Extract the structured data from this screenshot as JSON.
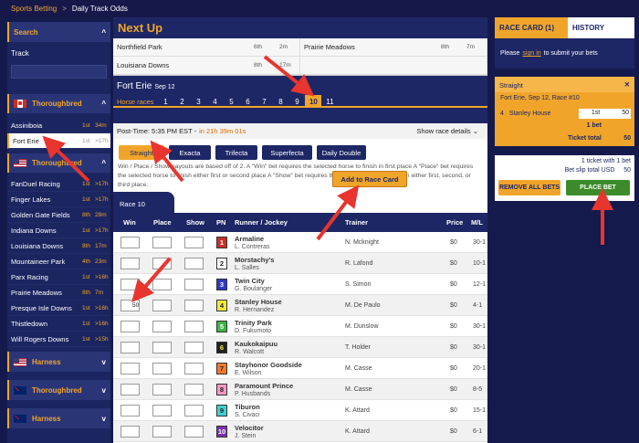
{
  "breadcrumb": {
    "parent": "Sports Betting",
    "separator": ">",
    "current": "Daily Track Odds"
  },
  "sidebar": {
    "search_label": "Search",
    "track_label": "Track",
    "groups": [
      {
        "label": "Thoroughbred",
        "flag": "canada-flag"
      },
      {
        "label": "Thoroughbred",
        "flag": "usa-flag"
      },
      {
        "label": "Harness",
        "flag": "usa-flag"
      },
      {
        "label": "Thoroughbred",
        "flag": "australia-flag"
      },
      {
        "label": "Harness",
        "flag": "australia-flag"
      }
    ],
    "canada_tracks": [
      {
        "name": "Assiniboia",
        "pos": "1st",
        "dist": "34m"
      },
      {
        "name": "Fort Erie",
        "pos": "1st",
        "dist": ">17h"
      }
    ],
    "usa_tracks": [
      {
        "name": "FanDuel Racing",
        "pos": "1st",
        "dist": ">17h"
      },
      {
        "name": "Finger Lakes",
        "pos": "1st",
        "dist": ">17h"
      },
      {
        "name": "Golden Gate Fields",
        "pos": "8th",
        "dist": "28m"
      },
      {
        "name": "Indiana Downs",
        "pos": "1st",
        "dist": ">17h"
      },
      {
        "name": "Louisiana Downs",
        "pos": "8th",
        "dist": "17m"
      },
      {
        "name": "Mountaineer Park",
        "pos": "4th",
        "dist": "23m"
      },
      {
        "name": "Parx Racing",
        "pos": "1st",
        "dist": ">16h"
      },
      {
        "name": "Prairie Meadows",
        "pos": "8th",
        "dist": "7m"
      },
      {
        "name": "Presque Isle Downs",
        "pos": "1st",
        "dist": ">16h"
      },
      {
        "name": "Thistledown",
        "pos": "1st",
        "dist": ">16h"
      },
      {
        "name": "Will Rogers Downs",
        "pos": "1st",
        "dist": ">15h"
      }
    ]
  },
  "nextup": {
    "title": "Next Up",
    "items": [
      {
        "name": "Northfield Park",
        "a": "6th",
        "b": "2m"
      },
      {
        "name": "Prairie Meadows",
        "a": "8th",
        "b": "7m"
      },
      {
        "name": "Louisiana Downs",
        "a": "8th",
        "b": "17m"
      },
      {
        "name": "",
        "a": "",
        "b": ""
      }
    ]
  },
  "race": {
    "track": "Fort Erie",
    "date": "Sep 12",
    "tabs_label": "Horse races",
    "tabs": [
      "1",
      "2",
      "3",
      "4",
      "5",
      "6",
      "7",
      "8",
      "9",
      "10",
      "11"
    ],
    "selected_tab": "10",
    "post_time_label": "Post-Time: 5:35 PM EST -",
    "post_time_remaining": "in 21h 39m 01s",
    "details_label": "Show race details",
    "bet_types": [
      "Straight",
      "Exacta",
      "Trifecta",
      "Superfecta",
      "Daily Double"
    ],
    "selected_bet_type": "Straight",
    "description": "Win / Place / Show payouts are based off of 2. A \"Win\" bet requires the selected horse to finish in first place A \"Place\" bet requires the selected horse to finish either first or second place A \"Show\" bet requires the selected horse to finish in either first, second, or third place.",
    "add_button": "Add to Race Card",
    "race_tab": "Race 10"
  },
  "table": {
    "headers": {
      "win": "Win",
      "place": "Place",
      "show": "Show",
      "pn": "PN",
      "runner": "Runner / Jockey",
      "trainer": "Trainer",
      "price": "Price",
      "ml": "M/L"
    },
    "rows": [
      {
        "pn": "1",
        "color": "#c7302a",
        "fg": "#fff",
        "runner": "Armaline",
        "jockey": "L. Contreras",
        "trainer": "N. Mcknight",
        "price": "$0",
        "ml": "30-1",
        "win": ""
      },
      {
        "pn": "2",
        "color": "#ffffff",
        "fg": "#222",
        "runner": "Morstachy's",
        "jockey": "L. Salles",
        "trainer": "R. Lafond",
        "price": "$0",
        "ml": "10-1",
        "win": ""
      },
      {
        "pn": "3",
        "color": "#2f39c9",
        "fg": "#fff",
        "runner": "Twin City",
        "jockey": "G. Boulanger",
        "trainer": "S. Simon",
        "price": "$0",
        "ml": "12-1",
        "win": ""
      },
      {
        "pn": "4",
        "color": "#f3e83a",
        "fg": "#222",
        "runner": "Stanley House",
        "jockey": "R. Hernandez",
        "trainer": "M. De Paulo",
        "price": "$0",
        "ml": "4-1",
        "win": "50"
      },
      {
        "pn": "5",
        "color": "#3fb444",
        "fg": "#fff",
        "runner": "Trinity Park",
        "jockey": "D. Fukumoto",
        "trainer": "M. Dunslow",
        "price": "$0",
        "ml": "30-1",
        "win": ""
      },
      {
        "pn": "6",
        "color": "#222222",
        "fg": "#f3e83a",
        "runner": "Kaukokaipuu",
        "jockey": "R. Walcott",
        "trainer": "T. Holder",
        "price": "$0",
        "ml": "30-1",
        "win": ""
      },
      {
        "pn": "7",
        "color": "#f07a2a",
        "fg": "#222",
        "runner": "Stayhonor Goodside",
        "jockey": "E. Wilson",
        "trainer": "M. Casse",
        "price": "$0",
        "ml": "20-1",
        "win": ""
      },
      {
        "pn": "8",
        "color": "#f59ac0",
        "fg": "#222",
        "runner": "Paramount Prince",
        "jockey": "P. Husbands",
        "trainer": "M. Casse",
        "price": "$0",
        "ml": "8-5",
        "win": ""
      },
      {
        "pn": "9",
        "color": "#3fd0d0",
        "fg": "#222",
        "runner": "Tiburon",
        "jockey": "S. Civaci",
        "trainer": "K. Attard",
        "price": "$0",
        "ml": "15-1",
        "win": ""
      },
      {
        "pn": "10",
        "color": "#7a2fb0",
        "fg": "#fff",
        "runner": "Velocitor",
        "jockey": "J. Stein",
        "trainer": "K. Attard",
        "price": "$0",
        "ml": "6-1",
        "win": ""
      }
    ]
  },
  "betslip": {
    "tab_racecard": "RACE CARD",
    "tab_racecard_count": "(1)",
    "tab_history": "HISTORY",
    "signin_pre": "Please",
    "signin_link": "sign in",
    "signin_post": "to submit your bets",
    "slip_title": "Straight",
    "slip_info": "Fort Erie, Sep 12, Race #10",
    "horse_pn": "4",
    "horse_name": "Stanley House",
    "bet_type": "1st",
    "bet_amount": "50",
    "bet_count": "1 bet",
    "ticket_total_label": "Ticket total",
    "ticket_total_value": "50",
    "summary_line1": "1 ticket with 1 bet",
    "summary_label2": "Bet slip total USD",
    "summary_value2": "50",
    "remove_all": "REMOVE ALL BETS",
    "place_bet": "PLACE BET"
  },
  "colors": {
    "navy": "#1d2765",
    "orange": "#f0a52a",
    "green": "#3c8b2a",
    "arrow": "#e8352e"
  }
}
